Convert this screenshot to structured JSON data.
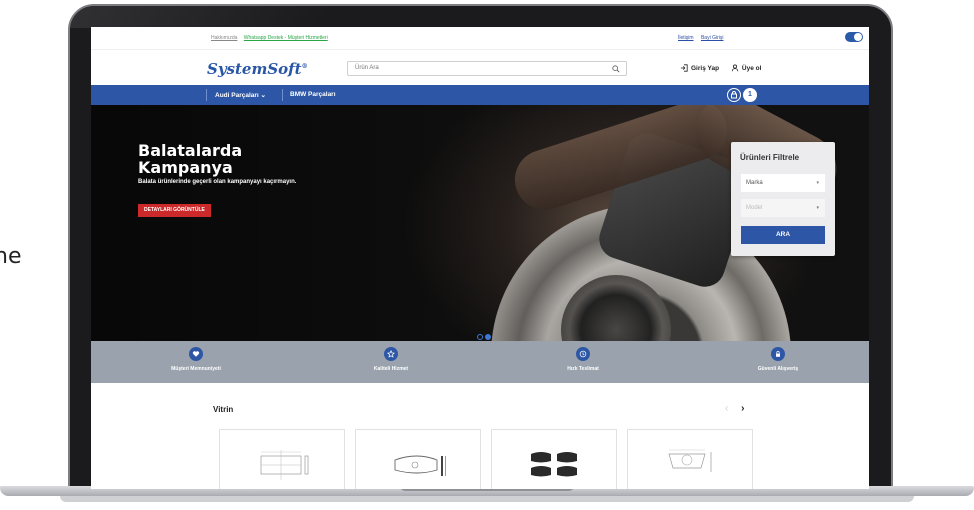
{
  "side_text": "ne",
  "topbar": {
    "links": [
      "Hakkımızda",
      "Whatsapp Destek - Müşteri Hizmetleri"
    ],
    "right_links": [
      "İletişim",
      "Bayi Girişi"
    ]
  },
  "header": {
    "logo": "SystemSoft",
    "logo_mark": "®",
    "search_placeholder": "Ürün Ara",
    "login": "Giriş Yap",
    "register": "Üye ol"
  },
  "nav": {
    "items": [
      "Audi Parçaları",
      "BMW Parçaları"
    ],
    "cart_count": "1"
  },
  "hero": {
    "title": "Balatalarda Kampanya",
    "description": "Balata ürünlerinde geçerli olan kampanyayı kaçırmayın.",
    "button": "DETAYLARI GÖRÜNTÜLE"
  },
  "filter": {
    "title": "Ürünleri Filtrele",
    "brand_placeholder": "Marka",
    "model_placeholder": "Model",
    "button": "ARA"
  },
  "features": [
    {
      "label": "Müşteri Memnuniyeti",
      "icon": "heart-icon"
    },
    {
      "label": "Kaliteli Hizmet",
      "icon": "star-icon"
    },
    {
      "label": "Hızlı Teslimat",
      "icon": "clock-icon"
    },
    {
      "label": "Güvenli Alışveriş",
      "icon": "lock-icon"
    }
  ],
  "showcase": {
    "title": "Vitrin"
  },
  "colors": {
    "brand": "#2d57a6",
    "accent_red": "#cc2a2a",
    "feature_bar": "#9aa3ad"
  }
}
